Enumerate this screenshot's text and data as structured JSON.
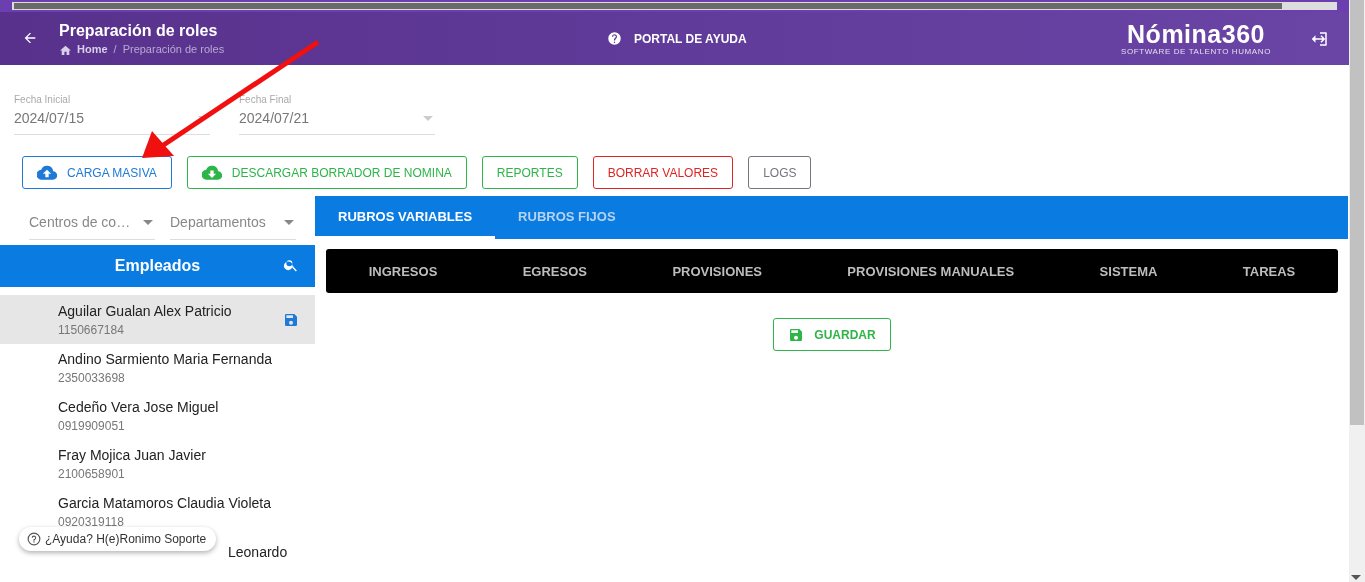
{
  "header": {
    "title": "Preparación de roles",
    "breadcrumb": [
      {
        "label": "Home"
      },
      {
        "label": "Preparación de roles"
      }
    ],
    "breadcrumb_separator": "/",
    "help_link": "PORTAL DE AYUDA",
    "logo": {
      "name": "Nómina360",
      "tagline": "SOFTWARE DE TALENTO HUMANO"
    }
  },
  "dates": [
    {
      "label": "Fecha Inicial",
      "value": "2024/07/15"
    },
    {
      "label": "Fecha Final",
      "value": "2024/07/21"
    }
  ],
  "actions": [
    {
      "label": "CARGA MASIVA",
      "kind": "upload",
      "color": "#1e7ad6"
    },
    {
      "label": "DESCARGAR BORRADOR DE NOMINA",
      "kind": "download",
      "color": "#2db548"
    },
    {
      "label": "REPORTES",
      "kind": "plain",
      "color": "#2db548"
    },
    {
      "label": "BORRAR VALORES",
      "kind": "plain",
      "color": "#e02424"
    },
    {
      "label": "LOGS",
      "kind": "plain",
      "color": "#77737f"
    }
  ],
  "filters": [
    {
      "placeholder": "Centros de co…"
    },
    {
      "placeholder": "Departamentos"
    }
  ],
  "employees": {
    "title": "Empleados",
    "items": [
      {
        "name": "Aguilar Gualan Alex Patricio",
        "id": "1150667184",
        "selected": true
      },
      {
        "name": "Andino Sarmiento Maria Fernanda",
        "id": "2350033698",
        "selected": false
      },
      {
        "name": "Cedeño Vera Jose Miguel",
        "id": "0919909051",
        "selected": false
      },
      {
        "name": "Fray Mojica Juan Javier",
        "id": "2100658901",
        "selected": false
      },
      {
        "name": "Garcia Matamoros Claudia Violeta",
        "id": "0920319118",
        "selected": false
      },
      {
        "name": "Leonardo",
        "kind": "covered",
        "selected": false
      }
    ]
  },
  "tabs": [
    {
      "label": "RUBROS VARIABLES",
      "selected": true
    },
    {
      "label": "RUBROS FIJOS",
      "selected": false
    }
  ],
  "subtabs": [
    {
      "label": "INGRESOS"
    },
    {
      "label": "EGRESOS"
    },
    {
      "label": "PROVISIONES"
    },
    {
      "label": "PROVISIONES MANUALES"
    },
    {
      "label": "SISTEMA"
    },
    {
      "label": "TAREAS"
    }
  ],
  "save_button": "GUARDAR",
  "help_chip": "¿Ayuda? H(e)Ronimo Soporte"
}
